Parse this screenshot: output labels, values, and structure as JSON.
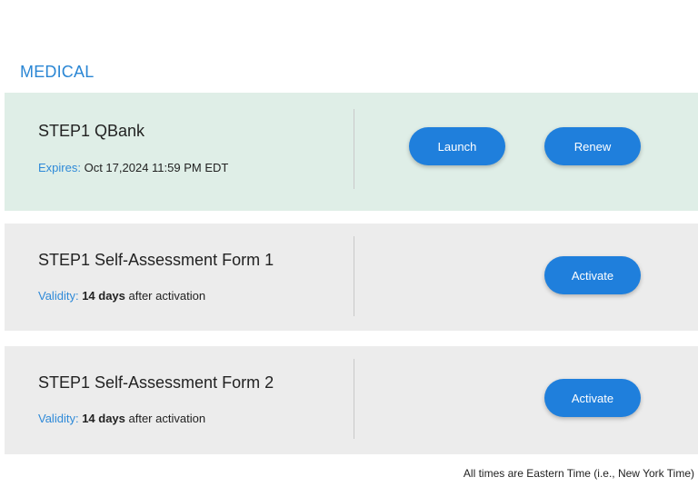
{
  "section": {
    "title": "MEDICAL"
  },
  "cards": [
    {
      "title": "STEP1 QBank",
      "meta_label": "Expires:",
      "meta_value": "Oct 17,2024 11:59 PM EDT",
      "buttons": {
        "launch": "Launch",
        "renew": "Renew"
      },
      "background": "#dfeee7"
    },
    {
      "title": "STEP1 Self-Assessment Form 1",
      "meta_label": "Validity:",
      "meta_strong": "14 days",
      "meta_suffix": " after activation",
      "buttons": {
        "activate": "Activate"
      },
      "background": "#ececec"
    },
    {
      "title": "STEP1 Self-Assessment Form 2",
      "meta_label": "Validity:",
      "meta_strong": "14 days",
      "meta_suffix": " after activation",
      "buttons": {
        "activate": "Activate"
      },
      "background": "#ececec"
    }
  ],
  "footnote": "All times are Eastern Time (i.e., New York Time)",
  "colors": {
    "accent": "#2a86d4",
    "button": "#1f7fdc"
  }
}
